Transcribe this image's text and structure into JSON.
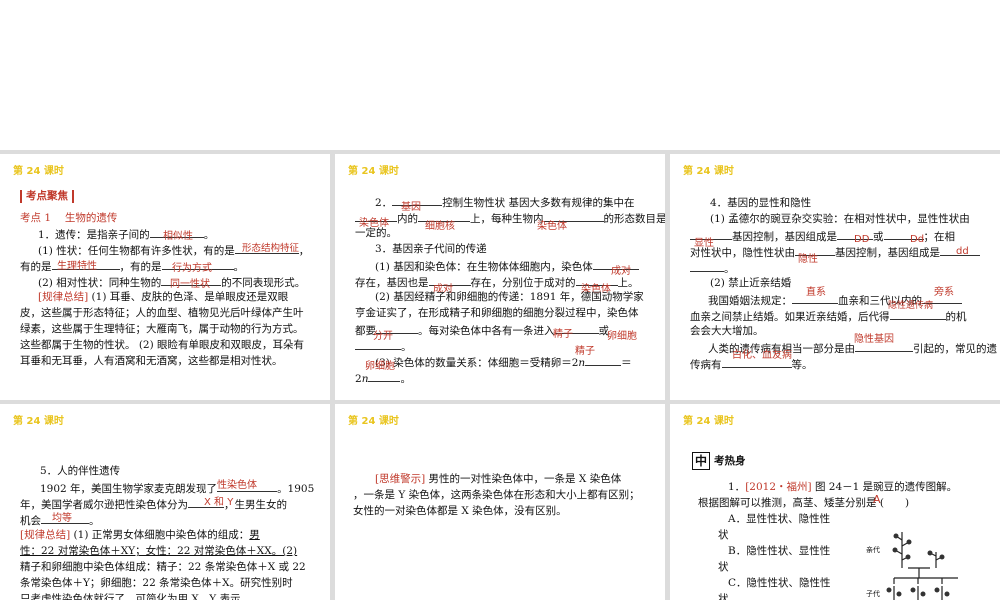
{
  "header": "第 24 课时",
  "slide1": {
    "tag": "考点聚焦",
    "point": "考点 1　 生物的遗传",
    "l1": "1．遗传：是指亲子间的",
    "a1": "相似性",
    "l1b": "。",
    "l2": "(1) 性状：任何生物都有许多性状，有的是",
    "a2": "形态结构特征",
    "l2b": "，",
    "l3": "有的是",
    "a3": "生理特性",
    "l3b": "，有的是",
    "a4": "行为方式",
    "l3c": "。",
    "l4a": "(2) 相对性状：同种生物的",
    "a5": "同一性状",
    "l4b": "的不同表现形式。",
    "l5a": "[规律总结]",
    "l5b": "(1) 耳垂、皮肤的色泽、是单眼皮还是双眼",
    "l6": "皮，这些属于形态特征；人的血型、植物见光后叶绿体产生叶",
    "l7": "绿素，这些属于生理特征；大雁南飞，属于动物的行为方式。",
    "l8": "这些都属于生物的性状。 (2) 眼睑有单眼皮和双眼皮，耳朵有",
    "l9": "耳垂和无耳垂，人有酒窝和无酒窝，这些都是相对性状。"
  },
  "slide2": {
    "l1a": "2．",
    "a1": "基因",
    "l1b": "控制生物性状 基因大多数有规律的集中在",
    "a2": "染色体",
    "l2a": "内的",
    "a3": "细胞核",
    "l2b": "上，每种生物内",
    "a4": "染色体",
    "l2c": "的形态数目是",
    "l3": "一定的。",
    "l4": "3．基因亲子代间的传递",
    "l5a": "(1) 基因和染色体：在生物体体细胞内，染色体",
    "a5": "成对",
    "l6a": "存在，基因也是",
    "a6": "成对",
    "l6b": "存在，分别位于成对的",
    "a7": "染色体",
    "l6c": "上。",
    "l7": "(2) 基因经精子和卵细胞的传递：1891 年，德国动物学家",
    "l8": "亨金证实了，在形成精子和卵细胞的细胞分裂过程中，染色体",
    "l9a": "都要",
    "a8": "分开",
    "l9b": "。每对染色体中各有一条进入",
    "a9": "精子",
    "l9c": "或",
    "a10": "卵细胞",
    "a11": "精子",
    "a12": "卵细胞",
    "l11": "(3) 染色体的数量关系：体细胞＝受精卵＝2",
    "l11n": "n",
    "l11b": "＝",
    "l12": "2",
    "l12n": "n",
    "l12b": "。"
  },
  "slide3": {
    "l1": "4．基因的显性和隐性",
    "l2": "(1) 孟德尔的豌豆杂交实验：在相对性状中，显性性状由",
    "a1": "显性",
    "l3a": "基因控制，基因组成是",
    "a2": "DD",
    "l3b": "或",
    "a3": "Dd",
    "l3c": "；在相",
    "l4a": "对性状中，隐性性状由",
    "a4": "隐性",
    "l4b": "基因控制，基因组成是",
    "a5": "dd",
    "l5": "。",
    "l6": "(2) 禁止近亲结婚",
    "a6": "直系",
    "a7": "旁系",
    "l7a": "我国婚姻法规定：",
    "l7b": "血亲和三代以内的",
    "a8": "隐性遗传病",
    "l8": "血亲之间禁止结婚。如果近亲结婚，后代得",
    "l8b": "的机",
    "l9": "会会大大增加。",
    "a9": "隐性基因",
    "l10a": "人类的遗传病有相当一部分是由",
    "l10b": "引起的，常见的遗",
    "a10": "白化、血友病",
    "l11a": "传病有",
    "l11b": "等。"
  },
  "slide4": {
    "l1": "5．人的伴性遗传",
    "l2a": "1902 年，美国生物学家麦克朗发现了",
    "a1": "性染色体",
    "l2b": "。1905",
    "l3a": "年，美国学者威尔逊把性染色体分为",
    "a2": "X 和 Y",
    "l3b": "，生男生女的",
    "l4a": "机会",
    "a3": "均等",
    "l4b": "。",
    "l5a": "[规律总结]",
    "l5b": "(1) 正常男女体细胞中染色体的组成：",
    "l5c": "男",
    "l6": "性：22 对常染色体＋XY；女性：22 对常染色体＋XX。(2)",
    "l7": "精子和卵细胞中染色体组成：精子：22 条常染色体＋X 或 22",
    "l8": "条常染色体＋Y；卵细胞：22 条常染色体＋X。研究性别时",
    "l9": "只考虑性染色体就行了，可简化为用 X、Y 表示。"
  },
  "slide5": {
    "l1a": "[思维警示]",
    "l1b": "男性的一对性染色体中，一条是 X 染色体",
    "l2": "，一条是 Y 染色体，这两条染色体在形态和大小上都有区别；",
    "l3": "女性的一对染色体都是 X 染色体，没有区别。"
  },
  "slide6": {
    "box": "中",
    "title": "考热身",
    "q1a": "1．",
    "q1tag": "[2012・福州]",
    "q1b": "图 24－1 是豌豆的遗传图解。",
    "q2": "根据图解可以推测，高茎、矮茎分别是",
    "ans": "A",
    "q2b": "(　　)",
    "optA": "A．显性性状、隐性性",
    "optA2": "状",
    "optB": "B．隐性性状、显性性",
    "optB2": "状",
    "optC": "C．隐性性状、隐性性",
    "optC2": "状",
    "fig1": "亲代",
    "fig2": "子代"
  }
}
